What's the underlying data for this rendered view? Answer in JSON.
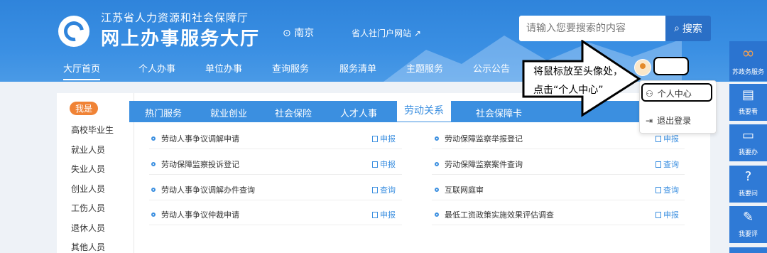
{
  "header": {
    "org_name": "江苏省人力资源和社会保障厅",
    "site_title": "网上办事服务大厅",
    "city": "南京",
    "portal_link": "省人社门户网站",
    "search_placeholder": "请输入您要搜索的内容",
    "search_button": "搜索"
  },
  "nav": [
    "大厅首页",
    "个人办事",
    "单位办事",
    "查询服务",
    "服务清单",
    "主题服务",
    "公示公告"
  ],
  "sidebar": {
    "badge": "我是",
    "items": [
      "高校毕业生",
      "就业人员",
      "失业人员",
      "创业人员",
      "工伤人员",
      "退休人员",
      "其他人员"
    ]
  },
  "tabs": [
    "热门服务",
    "就业创业",
    "社会保险",
    "人才人事",
    "劳动关系",
    "社会保障卡"
  ],
  "active_tab": "劳动关系",
  "services_left": [
    {
      "name": "劳动人事争议调解申请",
      "action": "申报"
    },
    {
      "name": "劳动保障监察投诉登记",
      "action": "申报"
    },
    {
      "name": "劳动人事争议调解办件查询",
      "action": "查询"
    },
    {
      "name": "劳动人事争议仲裁申请",
      "action": "申报"
    }
  ],
  "services_right": [
    {
      "name": "劳动保障监察举报登记",
      "action": "申报"
    },
    {
      "name": "劳动保障监察案件查询",
      "action": "查询"
    },
    {
      "name": "互联网庭审",
      "action": "查询"
    },
    {
      "name": "最低工资政策实施效果评估调查",
      "action": "申报"
    }
  ],
  "user_menu": {
    "profile": "个人中心",
    "logout": "退出登录"
  },
  "tutorial": {
    "line1": "将鼠标放至头像处，",
    "line2": "点击“个人中心”"
  },
  "floatbar": [
    "苏政务服务",
    "我要看",
    "我要办",
    "我要问",
    "我要评"
  ],
  "colors": {
    "primary": "#2f84db",
    "tab_bar": "#3b8fe0",
    "badge": "#f08336"
  }
}
